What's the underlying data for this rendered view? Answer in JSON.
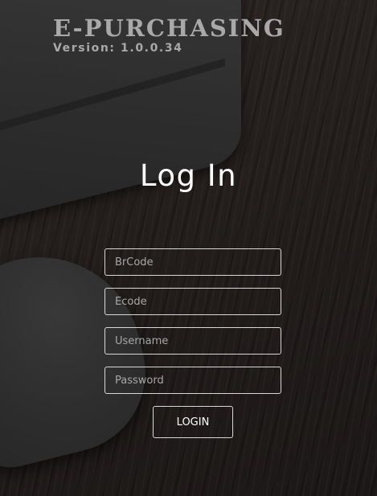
{
  "brand": {
    "title": "E-PURCHASING",
    "version": "Version: 1.0.0.34"
  },
  "login": {
    "heading": "Log In",
    "fields": {
      "brcode": {
        "placeholder": "BrCode",
        "value": ""
      },
      "ecode": {
        "placeholder": "Ecode",
        "value": ""
      },
      "username": {
        "placeholder": "Username",
        "value": ""
      },
      "password": {
        "placeholder": "Password",
        "value": ""
      }
    },
    "button_label": "LOGIN"
  },
  "background": {
    "description_icons": [
      "laptop-image",
      "mouse-image"
    ]
  }
}
